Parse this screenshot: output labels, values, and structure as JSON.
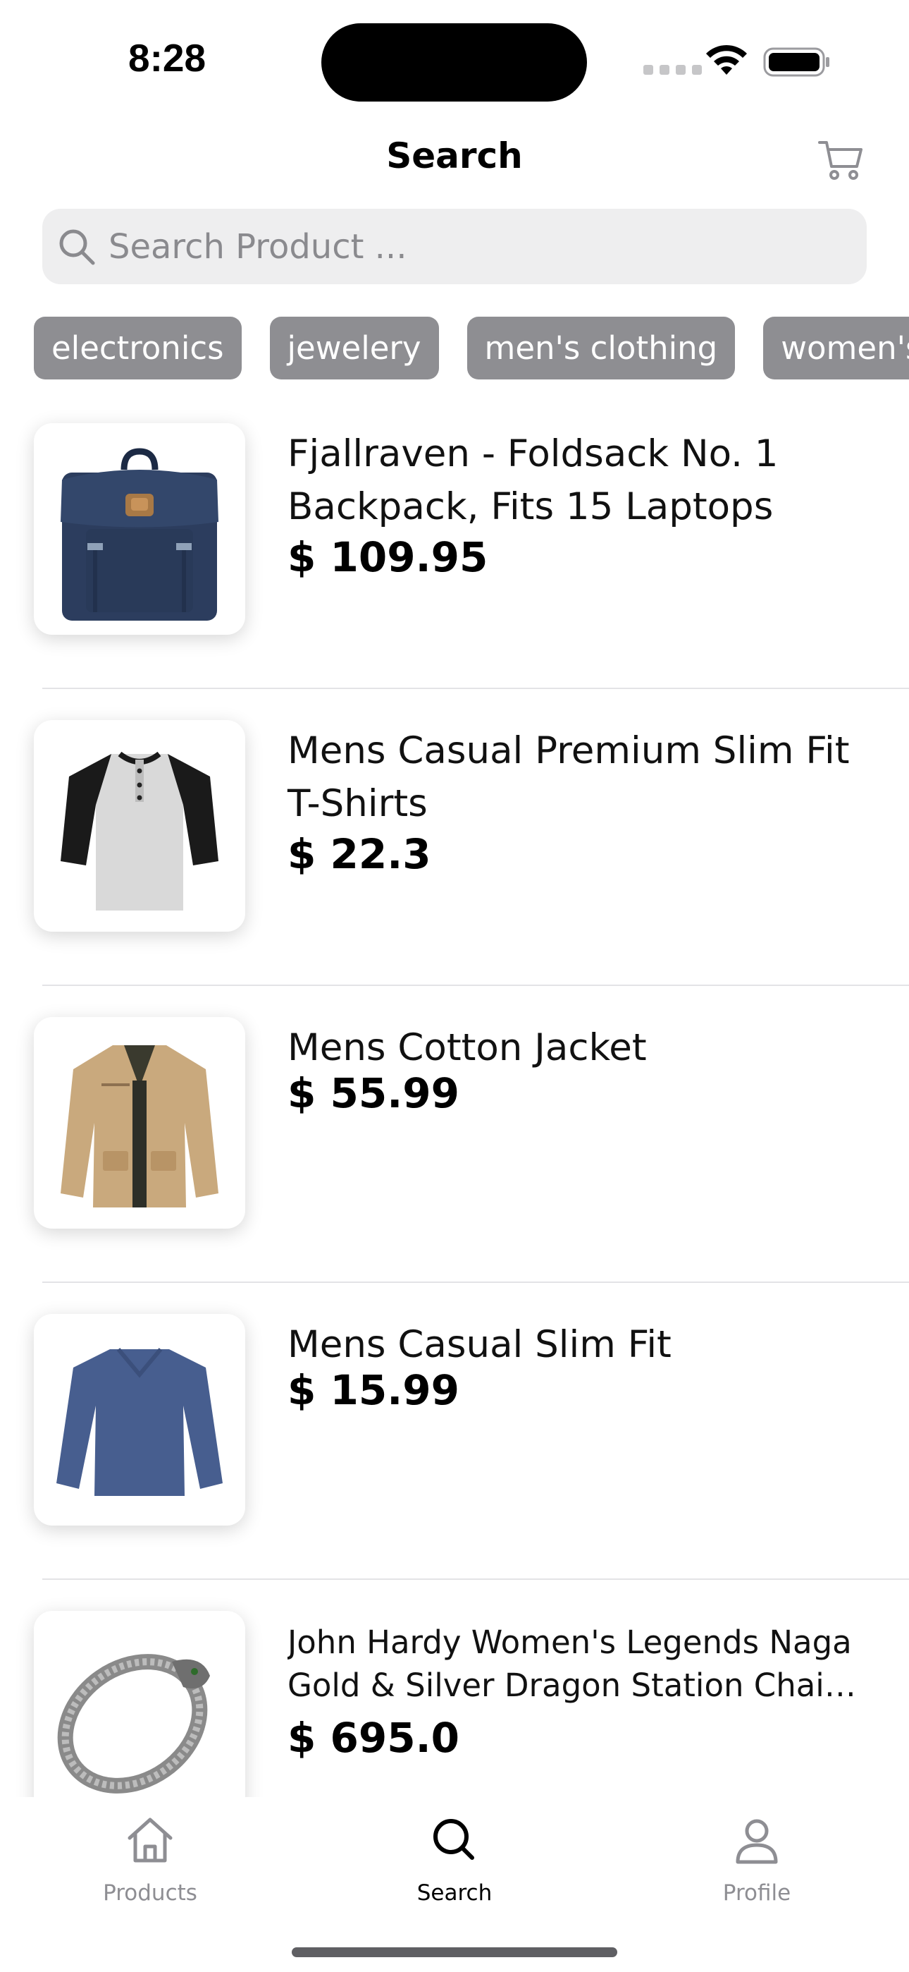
{
  "status_bar": {
    "time": "8:28"
  },
  "header": {
    "title": "Search",
    "cart_icon": "cart-icon"
  },
  "search": {
    "placeholder": "Search Product ...",
    "value": ""
  },
  "categories": [
    "electronics",
    "jewelery",
    "men's clothing",
    "women's clothing"
  ],
  "products": [
    {
      "title": "Fjallraven - Foldsack No. 1 Backpack, Fits 15 Laptops",
      "price": "$ 109.95",
      "image": "backpack"
    },
    {
      "title": "Mens Casual Premium Slim Fit T-Shirts",
      "price": "$ 22.3",
      "image": "raglan-tshirt"
    },
    {
      "title": "Mens Cotton Jacket",
      "price": "$ 55.99",
      "image": "cotton-jacket"
    },
    {
      "title": "Mens Casual Slim Fit",
      "price": "$ 15.99",
      "image": "long-sleeve-shirt"
    },
    {
      "title_line1": "John Hardy Women's Legends Naga",
      "title_line2": "Gold & Silver Dragon Station Chain B...",
      "price": "$ 695.0",
      "image": "dragon-bracelet"
    }
  ],
  "tabs": [
    {
      "label": "Products",
      "icon": "home-icon",
      "active": false
    },
    {
      "label": "Search",
      "icon": "search-icon",
      "active": true
    },
    {
      "label": "Profile",
      "icon": "person-icon",
      "active": false
    }
  ],
  "colors": {
    "chip_bg": "#8e8e92",
    "search_bg": "#eeeeef",
    "tab_inactive": "#8e8e93",
    "tab_active": "#000000"
  }
}
